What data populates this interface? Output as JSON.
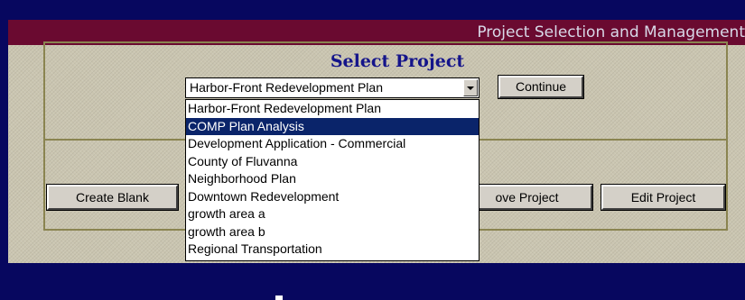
{
  "window": {
    "title": "Project Selection and Management"
  },
  "select_section": {
    "heading": "Select Project",
    "selected_value": "Harbor-Front Redevelopment Plan",
    "continue_label": "Continue"
  },
  "dropdown": {
    "highlighted_index": 1,
    "options": [
      "Harbor-Front Redevelopment Plan",
      "COMP Plan Analysis",
      "Development Application - Commercial",
      "County of Fluvanna",
      "Neighborhood Plan",
      "Downtown Redevelopment",
      "growth area a",
      "growth area b",
      "Regional Transportation"
    ]
  },
  "actions": {
    "create_blank_label": "Create Blank",
    "remove_project_label": "ove Project",
    "edit_project_label": "Edit Project"
  },
  "colors": {
    "background": "#07075f",
    "title_bar": "#6a0a30",
    "panel": "#cac5b0",
    "heading": "#14148a",
    "highlight": "#0a246a"
  }
}
